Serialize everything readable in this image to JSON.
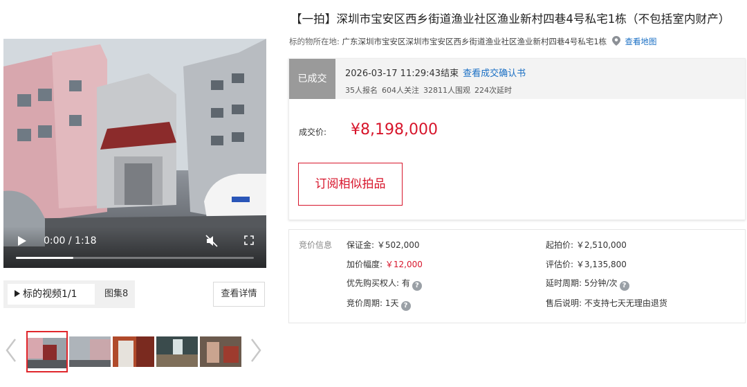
{
  "media": {
    "video": {
      "time": "0:00 / 1:18",
      "progress": 0.24
    },
    "tabs": {
      "video_label": "标的视频1/1",
      "album_label": "图集8"
    },
    "detail_button": "查看详情",
    "thumbnail_count": 5,
    "active_thumbnail": 1
  },
  "listing": {
    "title": "【一拍】深圳市宝安区西乡街道渔业社区渔业新村四巷4号私宅1栋（不包括室内财产）",
    "location_label": "标的物所在地:",
    "location_address": "广东深圳市宝安区深圳市宝安区西乡街道渔业社区渔业新村四巷4号私宅1栋",
    "map_link": "查看地图"
  },
  "deal": {
    "status": "已成交",
    "end_time": "2026-03-17 11:29:43结束",
    "confirm_link": "查看成交确认书",
    "stats": {
      "signups": "35人报名",
      "followers": "604人关注",
      "viewers": "32811人围观",
      "extensions": "224次延时"
    },
    "price_label": "成交价:",
    "price": "¥8,198,000",
    "subscribe_button": "订阅相似拍品"
  },
  "bid_info": {
    "title": "竞价信息",
    "deposit": "保证金: ￥502,000",
    "increment_label": "加价幅度: ",
    "increment_value": "￥12,000",
    "priority_buyer": "优先购买权人: 有",
    "bid_period": "竞价周期: 1天",
    "starting_price": "起拍价: ￥2,510,000",
    "appraisal": "评估价: ￥3,135,800",
    "extension_period": "延时周期: 5分钟/次",
    "after_sale": "售后说明: 不支持七天无理由退货"
  },
  "colors": {
    "accent_red": "#d7152b",
    "link_blue": "#1a6fc4",
    "status_gray": "#9a9a9a"
  }
}
